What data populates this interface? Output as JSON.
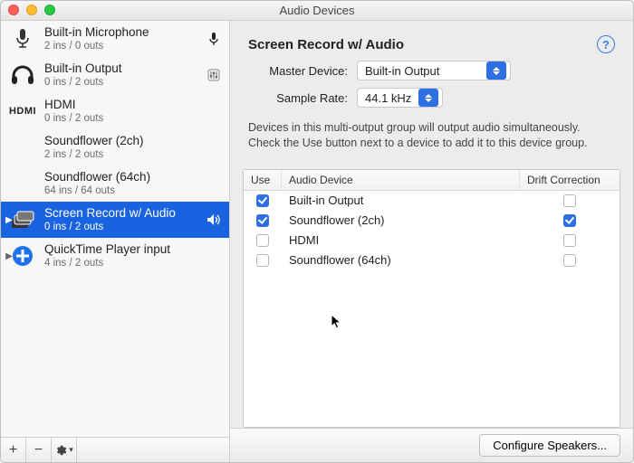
{
  "title": "Audio Devices",
  "sidebar": {
    "items": [
      {
        "name": "Built-in Microphone",
        "io": "2 ins / 0 outs",
        "icon": "mic",
        "badge": "mic",
        "disclosure": false
      },
      {
        "name": "Built-in Output",
        "io": "0 ins / 2 outs",
        "icon": "headphones",
        "badge": "slider",
        "disclosure": false
      },
      {
        "name": "HDMI",
        "io": "0 ins / 2 outs",
        "icon": "hdmi",
        "badge": "",
        "disclosure": false
      },
      {
        "name": "Soundflower (2ch)",
        "io": "2 ins / 2 outs",
        "icon": "",
        "badge": "",
        "disclosure": false
      },
      {
        "name": "Soundflower (64ch)",
        "io": "64 ins / 64 outs",
        "icon": "",
        "badge": "",
        "disclosure": false
      },
      {
        "name": "Screen Record w/ Audio",
        "io": "0 ins / 2 outs",
        "icon": "multi",
        "badge": "speaker",
        "selected": true,
        "disclosure": true
      },
      {
        "name": "QuickTime Player input",
        "io": "4 ins / 2 outs",
        "icon": "plus",
        "badge": "",
        "disclosure": true
      }
    ],
    "footer": {
      "add": "+",
      "remove": "−"
    }
  },
  "main": {
    "heading": "Screen Record w/ Audio",
    "help": "?",
    "master_label": "Master Device:",
    "master_value": "Built-in Output",
    "rate_label": "Sample Rate:",
    "rate_value": "44.1 kHz",
    "hint": "Devices in this multi-output group will output audio simultaneously. Check the Use button next to a device to add it to this device group.",
    "table": {
      "col_use": "Use",
      "col_name": "Audio Device",
      "col_drift": "Drift Correction",
      "rows": [
        {
          "use": true,
          "name": "Built-in Output",
          "drift": false
        },
        {
          "use": true,
          "name": "Soundflower (2ch)",
          "drift": true
        },
        {
          "use": false,
          "name": "HDMI",
          "drift": false
        },
        {
          "use": false,
          "name": "Soundflower (64ch)",
          "drift": false
        }
      ]
    },
    "configure": "Configure Speakers..."
  }
}
